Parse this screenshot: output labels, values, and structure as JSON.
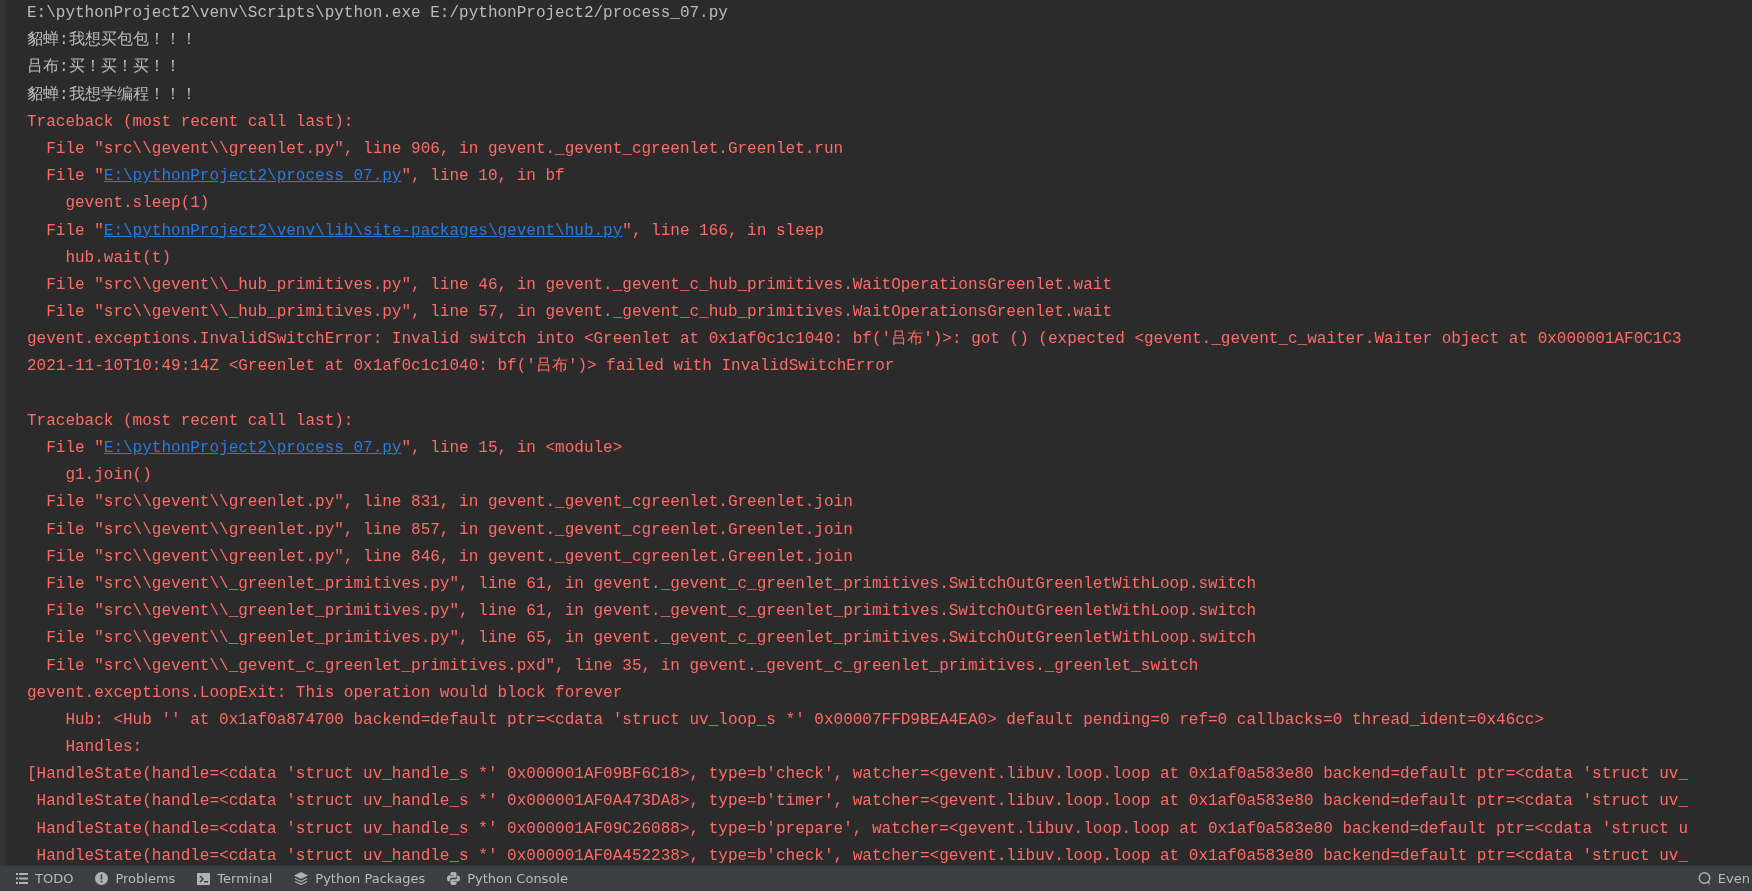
{
  "console": {
    "lines": [
      {
        "kind": "stdout",
        "text": "E:\\pythonProject2\\venv\\Scripts\\python.exe E:/pythonProject2/process_07.py"
      },
      {
        "kind": "stdout",
        "text": "貂蝉:我想买包包！！！"
      },
      {
        "kind": "stdout",
        "text": "吕布:买！买！买！！"
      },
      {
        "kind": "stdout",
        "text": "貂蝉:我想学编程！！！"
      },
      {
        "kind": "stderr",
        "text": "Traceback (most recent call last):"
      },
      {
        "kind": "stderr",
        "text": "  File \"src\\\\gevent\\\\greenlet.py\", line 906, in gevent._gevent_cgreenlet.Greenlet.run"
      },
      {
        "kind": "stderr",
        "prefix": "  File \"",
        "link": "E:\\pythonProject2\\process_07.py",
        "suffix": "\", line 10, in bf"
      },
      {
        "kind": "stderr",
        "text": "    gevent.sleep(1)"
      },
      {
        "kind": "stderr",
        "prefix": "  File \"",
        "link": "E:\\pythonProject2\\venv\\lib\\site-packages\\gevent\\hub.py",
        "suffix": "\", line 166, in sleep"
      },
      {
        "kind": "stderr",
        "text": "    hub.wait(t)"
      },
      {
        "kind": "stderr",
        "text": "  File \"src\\\\gevent\\\\_hub_primitives.py\", line 46, in gevent._gevent_c_hub_primitives.WaitOperationsGreenlet.wait"
      },
      {
        "kind": "stderr",
        "text": "  File \"src\\\\gevent\\\\_hub_primitives.py\", line 57, in gevent._gevent_c_hub_primitives.WaitOperationsGreenlet.wait"
      },
      {
        "kind": "stderr",
        "text": "gevent.exceptions.InvalidSwitchError: Invalid switch into <Greenlet at 0x1af0c1c1040: bf('吕布')>: got () (expected <gevent._gevent_c_waiter.Waiter object at 0x000001AF0C1C3"
      },
      {
        "kind": "stderr",
        "text": "2021-11-10T10:49:14Z <Greenlet at 0x1af0c1c1040: bf('吕布')> failed with InvalidSwitchError"
      },
      {
        "kind": "blank"
      },
      {
        "kind": "stderr",
        "text": "Traceback (most recent call last):"
      },
      {
        "kind": "stderr",
        "prefix": "  File \"",
        "link": "E:\\pythonProject2\\process_07.py",
        "suffix": "\", line 15, in <module>"
      },
      {
        "kind": "stderr",
        "text": "    g1.join()"
      },
      {
        "kind": "stderr",
        "text": "  File \"src\\\\gevent\\\\greenlet.py\", line 831, in gevent._gevent_cgreenlet.Greenlet.join"
      },
      {
        "kind": "stderr",
        "text": "  File \"src\\\\gevent\\\\greenlet.py\", line 857, in gevent._gevent_cgreenlet.Greenlet.join"
      },
      {
        "kind": "stderr",
        "text": "  File \"src\\\\gevent\\\\greenlet.py\", line 846, in gevent._gevent_cgreenlet.Greenlet.join"
      },
      {
        "kind": "stderr",
        "text": "  File \"src\\\\gevent\\\\_greenlet_primitives.py\", line 61, in gevent._gevent_c_greenlet_primitives.SwitchOutGreenletWithLoop.switch"
      },
      {
        "kind": "stderr",
        "text": "  File \"src\\\\gevent\\\\_greenlet_primitives.py\", line 61, in gevent._gevent_c_greenlet_primitives.SwitchOutGreenletWithLoop.switch"
      },
      {
        "kind": "stderr",
        "text": "  File \"src\\\\gevent\\\\_greenlet_primitives.py\", line 65, in gevent._gevent_c_greenlet_primitives.SwitchOutGreenletWithLoop.switch"
      },
      {
        "kind": "stderr",
        "text": "  File \"src\\\\gevent\\\\_gevent_c_greenlet_primitives.pxd\", line 35, in gevent._gevent_c_greenlet_primitives._greenlet_switch"
      },
      {
        "kind": "stderr",
        "text": "gevent.exceptions.LoopExit: This operation would block forever"
      },
      {
        "kind": "stderr",
        "text": "    Hub: <Hub '' at 0x1af0a874700 backend=default ptr=<cdata 'struct uv_loop_s *' 0x00007FFD9BEA4EA0> default pending=0 ref=0 callbacks=0 thread_ident=0x46cc>"
      },
      {
        "kind": "stderr",
        "text": "    Handles:"
      },
      {
        "kind": "stderr",
        "text": "[HandleState(handle=<cdata 'struct uv_handle_s *' 0x000001AF09BF6C18>, type=b'check', watcher=<gevent.libuv.loop.loop at 0x1af0a583e80 backend=default ptr=<cdata 'struct uv_"
      },
      {
        "kind": "stderr",
        "text": " HandleState(handle=<cdata 'struct uv_handle_s *' 0x000001AF0A473DA8>, type=b'timer', watcher=<gevent.libuv.loop.loop at 0x1af0a583e80 backend=default ptr=<cdata 'struct uv_"
      },
      {
        "kind": "stderr",
        "text": " HandleState(handle=<cdata 'struct uv_handle_s *' 0x000001AF09C26088>, type=b'prepare', watcher=<gevent.libuv.loop.loop at 0x1af0a583e80 backend=default ptr=<cdata 'struct u"
      },
      {
        "kind": "stderr",
        "text": " HandleState(handle=<cdata 'struct uv_handle_s *' 0x000001AF0A452238>, type=b'check', watcher=<gevent.libuv.loop.loop at 0x1af0a583e80 backend=default ptr=<cdata 'struct uv_"
      }
    ]
  },
  "tool_window_bar": {
    "tabs": [
      {
        "kind": "todo",
        "label": "TODO"
      },
      {
        "kind": "problems",
        "label": "Problems"
      },
      {
        "kind": "terminal",
        "label": "Terminal"
      },
      {
        "kind": "packages",
        "label": "Python Packages"
      },
      {
        "kind": "console",
        "label": "Python Console"
      }
    ],
    "right_label": "Even"
  }
}
